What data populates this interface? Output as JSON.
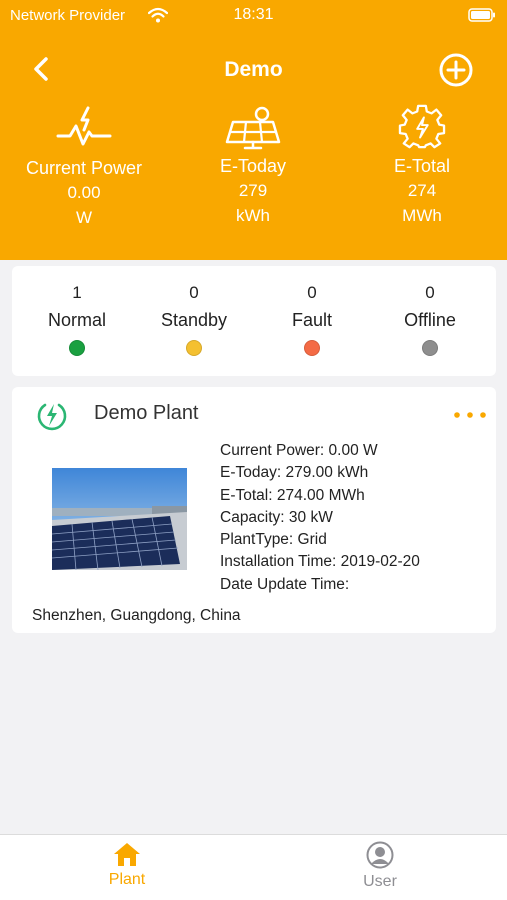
{
  "status_bar": {
    "carrier": "Network Provider",
    "time": "18:31"
  },
  "nav": {
    "title": "Demo",
    "back_icon": "chevron-left-icon",
    "add_icon": "plus-circle-icon"
  },
  "colors": {
    "brand": "#f9a800",
    "normal": "#1aa040",
    "standby": "#f4c030",
    "fault": "#f46a45",
    "offline": "#8e8e8e"
  },
  "stats": {
    "current_power": {
      "label": "Current Power",
      "value": "0.00",
      "unit": "W",
      "icon": "power-pulse-icon"
    },
    "e_today": {
      "label": "E-Today",
      "value": "279",
      "unit": "kWh",
      "icon": "solar-panel-icon"
    },
    "e_total": {
      "label": "E-Total",
      "value": "274",
      "unit": "MWh",
      "icon": "gear-bolt-icon"
    }
  },
  "device_status": [
    {
      "count": "1",
      "label": "Normal"
    },
    {
      "count": "0",
      "label": "Standby"
    },
    {
      "count": "0",
      "label": "Fault"
    },
    {
      "count": "0",
      "label": "Offline"
    }
  ],
  "plant": {
    "name": "Demo Plant",
    "icon": "bolt-circle-icon",
    "details": [
      "Current Power: 0.00 W",
      "E-Today: 279.00 kWh",
      "E-Total: 274.00 MWh",
      "Capacity: 30 kW",
      "PlantType: Grid",
      "Installation Time: 2019-02-20",
      "Date Update Time:"
    ],
    "location": "Shenzhen, Guangdong, China"
  },
  "tabs": [
    {
      "label": "Plant",
      "icon": "home-icon",
      "active": true
    },
    {
      "label": "User",
      "icon": "user-icon",
      "active": false
    }
  ]
}
